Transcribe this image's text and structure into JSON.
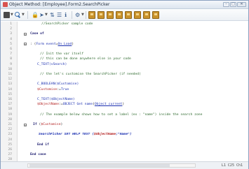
{
  "window": {
    "title": "Object Method: [Employee].Form2.SearchPicker",
    "min_label": "–",
    "max_label": "□",
    "close_label": "✕"
  },
  "toolbar": {
    "icons": [
      "stop-icon",
      "search-icon",
      "lock-icon",
      "run-icon",
      "sort-icon",
      "info-icon",
      "tool-icon",
      "gold-clip-icon"
    ]
  },
  "editor": {
    "lines": [
      {
        "n": "1",
        "t": "//SearchPicker sample code",
        "c": "cmt"
      },
      {
        "n": "2",
        "t": "",
        "c": ""
      },
      {
        "n": "3",
        "t": "Case of",
        "c": "kw",
        "fold": "minus"
      },
      {
        "n": "4",
        "t": "",
        "c": ""
      },
      {
        "n": "5",
        "t": ": (Form event=On Load)",
        "c": "mixed1",
        "fold": "minus"
      },
      {
        "n": "6",
        "t": "",
        "c": ""
      },
      {
        "n": "7",
        "t": "// Init the var itself",
        "c": "cmt"
      },
      {
        "n": "8",
        "t": "// this can be done anywhere else in your code",
        "c": "cmt"
      },
      {
        "n": "9",
        "t": "C_TEXT(vSearch)",
        "c": "cmd"
      },
      {
        "n": "10",
        "t": "",
        "c": ""
      },
      {
        "n": "11",
        "t": "// the let's customise the SearchPicker (if needed)",
        "c": "cmt"
      },
      {
        "n": "12",
        "t": "",
        "c": ""
      },
      {
        "n": "13",
        "t": "C_BOOLEAN($Customise)",
        "c": "cmd"
      },
      {
        "n": "14",
        "t": "$Customise:=True",
        "c": "mixed2"
      },
      {
        "n": "15",
        "t": "",
        "c": ""
      },
      {
        "n": "16",
        "t": "C_TEXT($ObjectName)",
        "c": "cmd"
      },
      {
        "n": "17",
        "t": "$ObjectName:=OBJECT Get name(Object current)",
        "c": "mixed3"
      },
      {
        "n": "18",
        "t": "",
        "c": ""
      },
      {
        "n": "19",
        "t": "// The example below shows how to set a label (ex : \"name\") inside the search zone",
        "c": "cmt"
      },
      {
        "n": "20",
        "t": "",
        "c": ""
      },
      {
        "n": "21",
        "t": "If ($Customise)",
        "c": "mixed4",
        "fold": "minus"
      },
      {
        "n": "22",
        "t": "",
        "c": ""
      },
      {
        "n": "23",
        "t": "SearchPicker SET HELP TEXT ($ObjectName;\"Name\")",
        "c": "mixed5"
      },
      {
        "n": "24",
        "t": "",
        "c": ""
      },
      {
        "n": "25",
        "t": "End if",
        "c": "kw"
      },
      {
        "n": "26",
        "t": "",
        "c": ""
      },
      {
        "n": "27",
        "t": "End case",
        "c": "kw"
      },
      {
        "n": "28",
        "t": "",
        "c": ""
      }
    ]
  },
  "status": {
    "text": "L1  C25  Ch1"
  }
}
